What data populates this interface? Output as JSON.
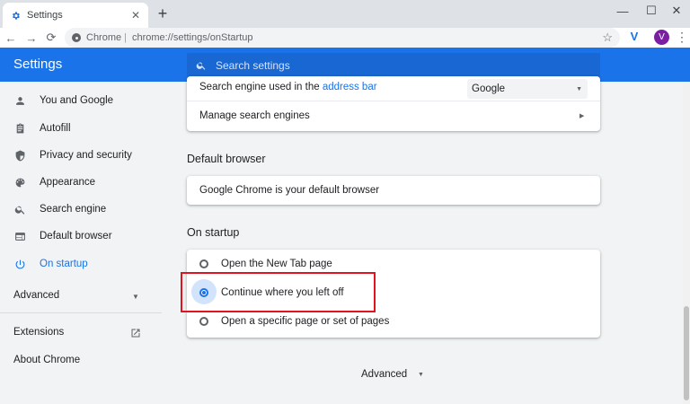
{
  "tab": {
    "title": "Settings",
    "close": "✕",
    "new_tab": "+"
  },
  "window_controls": {
    "minimize": "—",
    "maximize": "☐",
    "close": "✕"
  },
  "toolbar": {
    "back": "←",
    "forward": "→",
    "reload": "⟳",
    "omnibox_label": "Chrome",
    "omnibox_separator": "|",
    "omnibox_url": "chrome://settings/onStartup",
    "star": "☆",
    "extension_letter": "V",
    "avatar_letter": "V",
    "menu": "⋮"
  },
  "header": {
    "title": "Settings",
    "search_placeholder": "Search settings"
  },
  "sidebar": {
    "items": [
      {
        "label": "You and Google",
        "icon": "person-icon"
      },
      {
        "label": "Autofill",
        "icon": "clipboard-icon"
      },
      {
        "label": "Privacy and security",
        "icon": "shield-icon"
      },
      {
        "label": "Appearance",
        "icon": "palette-icon"
      },
      {
        "label": "Search engine",
        "icon": "search-icon"
      },
      {
        "label": "Default browser",
        "icon": "browser-icon"
      },
      {
        "label": "On startup",
        "icon": "power-icon",
        "active": true
      }
    ],
    "advanced": "Advanced",
    "extensions": "Extensions",
    "about": "About Chrome"
  },
  "search_engine_card": {
    "used_in_prefix": "Search engine used in the ",
    "used_in_link": "address bar",
    "selected_engine": "Google",
    "manage": "Manage search engines"
  },
  "default_browser": {
    "title": "Default browser",
    "status": "Google Chrome is your default browser"
  },
  "on_startup": {
    "title": "On startup",
    "options": [
      {
        "label": "Open the New Tab page",
        "checked": false
      },
      {
        "label": "Continue where you left off",
        "checked": true
      },
      {
        "label": "Open a specific page or set of pages",
        "checked": false
      }
    ]
  },
  "footer": {
    "advanced": "Advanced"
  },
  "colors": {
    "accent": "#1a73e8",
    "highlight": "#e1131e",
    "avatar": "#7b1fa2"
  }
}
